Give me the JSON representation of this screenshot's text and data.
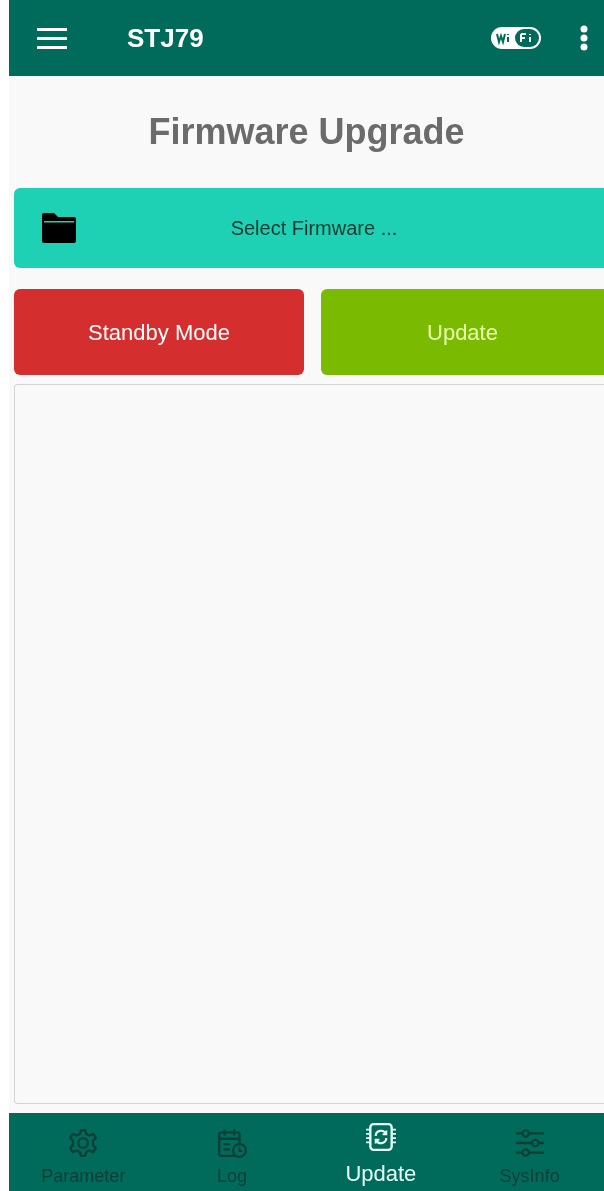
{
  "app_bar": {
    "title": "STJ79"
  },
  "page_title": "Firmware Upgrade",
  "select_button": {
    "label": "Select Firmware ..."
  },
  "actions": [
    {
      "kind": "standby",
      "label": "Standby Mode"
    },
    {
      "kind": "update",
      "label": "Update"
    }
  ],
  "bottom_nav": [
    {
      "kind": "parameter",
      "label": "Parameter",
      "selected": false
    },
    {
      "kind": "log",
      "label": "Log",
      "selected": false
    },
    {
      "kind": "update",
      "label": "Update",
      "selected": true
    },
    {
      "kind": "sysinfo",
      "label": "SysInfo",
      "selected": false
    }
  ]
}
